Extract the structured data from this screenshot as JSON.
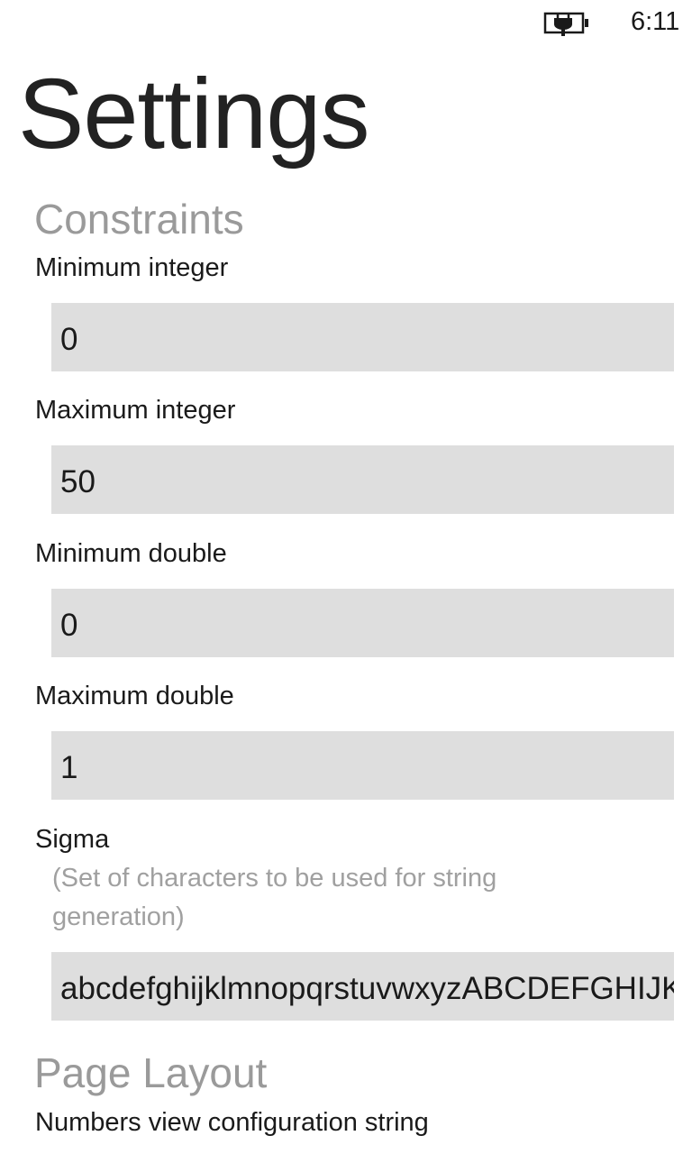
{
  "status_bar": {
    "battery_icon": "battery-charging-icon",
    "time": "6:11"
  },
  "page": {
    "title": "Settings"
  },
  "sections": {
    "constraints": {
      "header": "Constraints",
      "min_integer": {
        "label": "Minimum integer",
        "value": "0"
      },
      "max_integer": {
        "label": "Maximum integer",
        "value": "50"
      },
      "min_double": {
        "label": "Minimum double",
        "value": "0"
      },
      "max_double": {
        "label": "Maximum double",
        "value": "1"
      },
      "sigma": {
        "label": "Sigma",
        "hint": "(Set of characters to be used for string generation)",
        "value": "abcdefghijklmnopqrstuvwxyzABCDEFGHIJKLMNOPQRSTUVWXYZ"
      }
    },
    "page_layout": {
      "header": "Page Layout",
      "numbers_view_config": {
        "label": "Numbers view configuration string"
      }
    }
  },
  "colors": {
    "background": "#ffffff",
    "textbox_background": "#dedede",
    "section_header": "#9a9a9a",
    "hint_text": "#a0a0a0"
  }
}
